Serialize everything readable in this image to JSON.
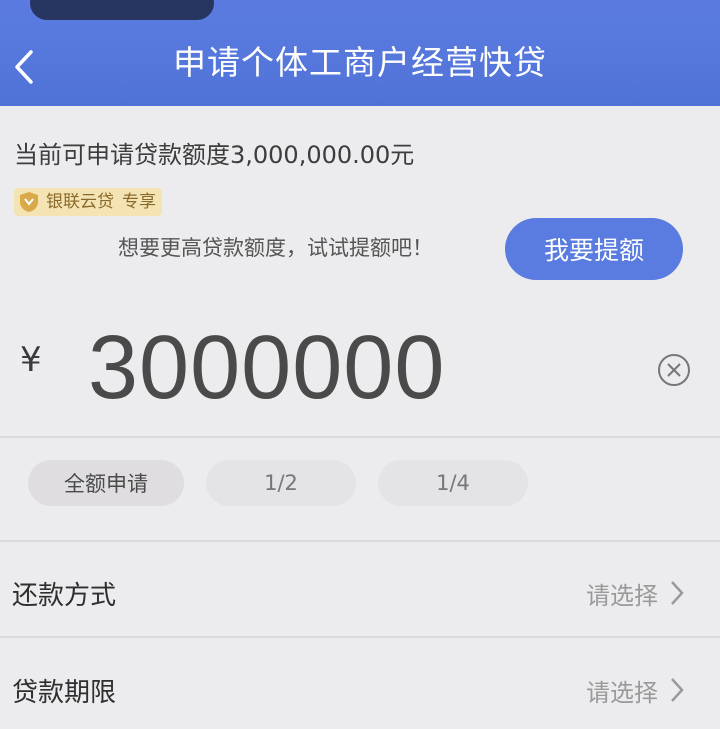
{
  "header": {
    "title": "申请个体工商户经营快贷"
  },
  "quota_text": "当前可申请贷款额度3,000,000.00元",
  "badge": {
    "name": "银联云贷",
    "tag": "专享"
  },
  "hint_text": "想要更高贷款额度，试试提额吧！",
  "raise_button_label": "我要提额",
  "amount": {
    "currency": "¥",
    "value": "3000000"
  },
  "chips": [
    {
      "label": "全额申请",
      "selected": true
    },
    {
      "label": "1/2",
      "selected": false
    },
    {
      "label": "1/4",
      "selected": false
    }
  ],
  "rows": [
    {
      "label": "还款方式",
      "value": "请选择"
    },
    {
      "label": "贷款期限",
      "value": "请选择"
    }
  ],
  "colors": {
    "header_blue": "#5577dc",
    "button_blue": "#5a7be0",
    "badge_bg": "#f4e4b4",
    "badge_text": "#8a6a2c"
  }
}
